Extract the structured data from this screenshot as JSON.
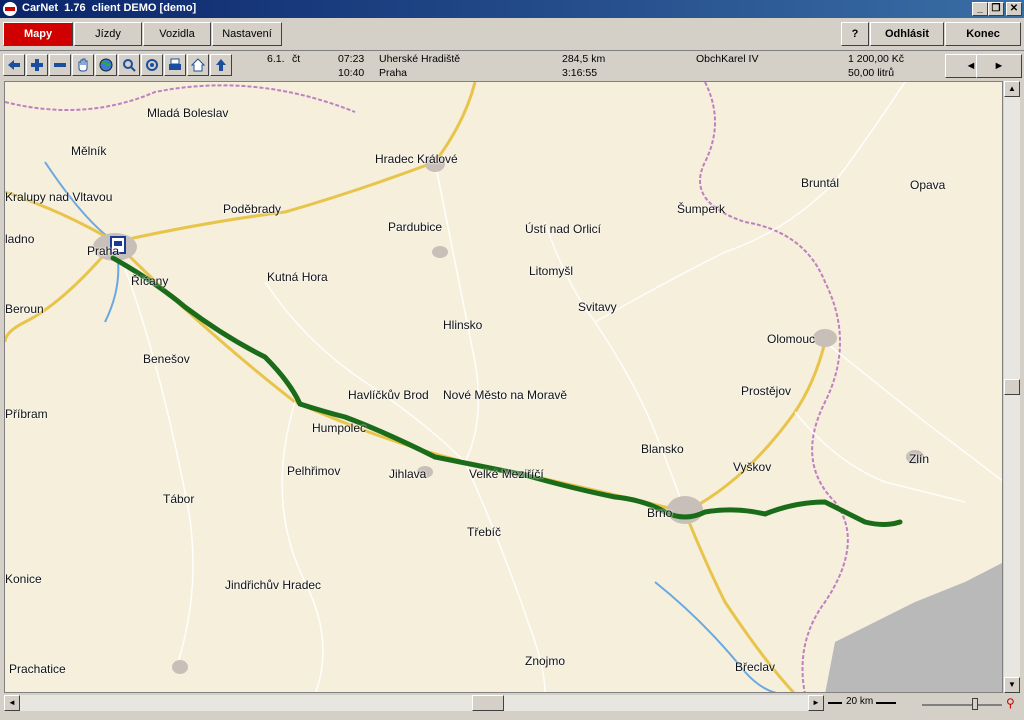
{
  "window": {
    "title": "CarNet  1.76  client DEMO [demo]",
    "minimize": "_",
    "maximize": "❐",
    "close": "✕"
  },
  "tabs": [
    {
      "label": "Mapy",
      "active": true
    },
    {
      "label": "Jízdy",
      "active": false
    },
    {
      "label": "Vozidla",
      "active": false
    },
    {
      "label": "Nastavení",
      "active": false
    }
  ],
  "right_buttons": {
    "help": "?",
    "logout": "Odhlásit",
    "exit": "Konec"
  },
  "toolbar_icons": [
    "arrow-left-icon",
    "zoom-in-icon",
    "zoom-out-icon",
    "hand-icon",
    "globe-icon",
    "magnifier-icon",
    "target-icon",
    "print-icon",
    "home-icon",
    "arrow-up-icon"
  ],
  "trip": {
    "date": "6.1.",
    "day": "čt",
    "time_start": "07:23",
    "time_end": "10:40",
    "from": "Uherské Hradiště",
    "to": "Praha",
    "distance": "284,5 km",
    "duration": "3:16:55",
    "driver": "ObchKarel  IV",
    "cost": "1 200,00 Kč",
    "fuel": "50,00 litrů"
  },
  "nav": {
    "prev": "◄",
    "next": "►"
  },
  "cities": [
    "Mladá Boleslav",
    "Mělník",
    "Hradec Králové",
    "Kralupy nad Vltavou",
    "Poděbrady",
    "Bruntál",
    "Opava",
    "Šumperk",
    "Pardubice",
    "Ústí nad Orlicí",
    "ladno",
    "Praha",
    "Říčany",
    "Kutná Hora",
    "Litomyšl",
    "Beroun",
    "Svitavy",
    "Hlinsko",
    "Olomouc",
    "Benešov",
    "Prostějov",
    "Havlíčkův Brod",
    "Nové Město na Moravě",
    "Příbram",
    "Humpolec",
    "Blansko",
    "Vyškov",
    "Pelhřimov",
    "Jihlava",
    "Velké Meziříčí",
    "Zlín",
    "Tábor",
    "Brno",
    "Třebíč",
    "Konice",
    "Jindřichův Hradec",
    "Prachatice",
    "Znojmo",
    "Břeclav"
  ],
  "scale": {
    "label": "20 km"
  },
  "colors": {
    "accent_red": "#d00000",
    "route": "#1a6b1a",
    "map_bg": "#f5efdc"
  }
}
